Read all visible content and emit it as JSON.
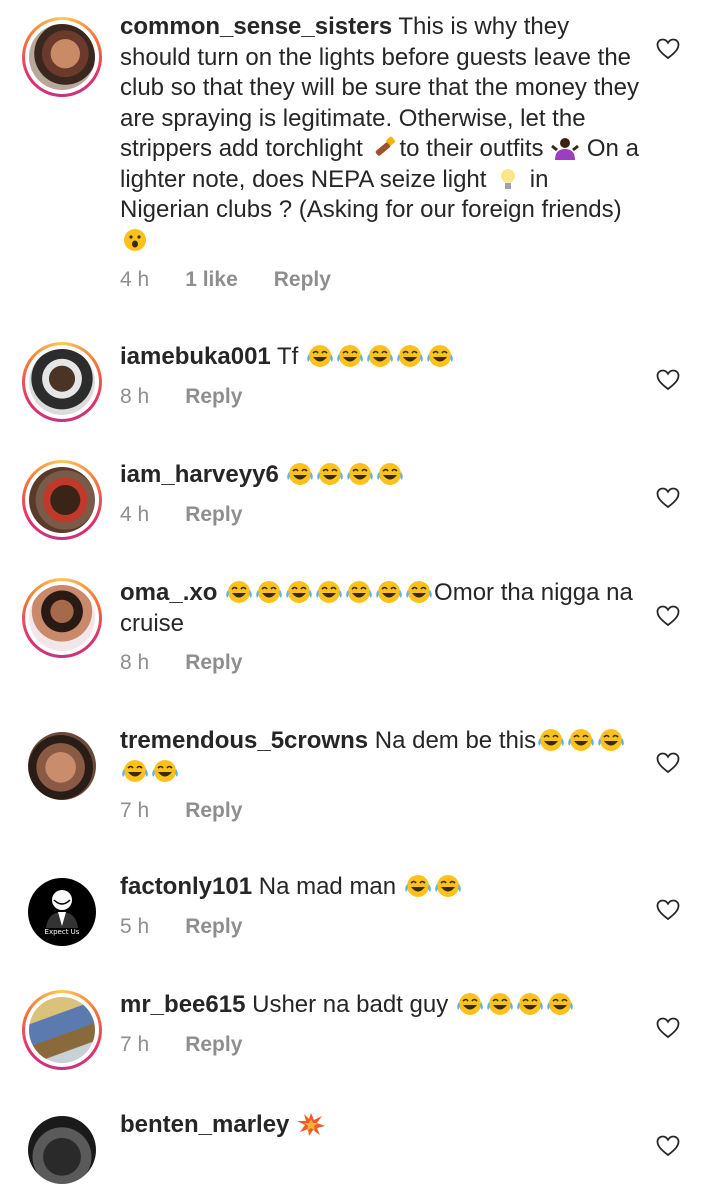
{
  "colors": {
    "text": "#262626",
    "meta": "#8e8e8e",
    "story_ring": "gradient-orange-pink"
  },
  "comments": [
    {
      "username": "common_sense_sisters",
      "text_parts": [
        "This is why they should turn on the lights before guests leave the club so that they will be sure that the money they are spraying is legitimate. Otherwise, let the strippers add torchlight ",
        "to their outfits ",
        " On a lighter note, does NEPA seize light ",
        " in Nigerian clubs ? (Asking for our foreign friends) "
      ],
      "time": "4 h",
      "likes": "1 like",
      "reply": "Reply",
      "emojis": [
        "flashlight-emoji",
        "shrug-woman-emoji",
        "light-bulb-emoji",
        "astonished-face-emoji"
      ]
    },
    {
      "username": "iamebuka001",
      "text": "Tf",
      "time": "8 h",
      "reply": "Reply",
      "emojis": [
        "laughing-tears-emoji",
        "laughing-tears-emoji",
        "laughing-tears-emoji",
        "laughing-tears-emoji",
        "laughing-tears-emoji"
      ]
    },
    {
      "username": "iam_harveyy6",
      "text": "",
      "time": "4 h",
      "reply": "Reply",
      "emojis": [
        "laughing-tears-emoji",
        "laughing-tears-emoji",
        "laughing-tears-emoji",
        "laughing-tears-emoji"
      ]
    },
    {
      "username": "oma_.xo",
      "text": "Omor tha nigga na cruise",
      "time": "8 h",
      "reply": "Reply",
      "emojis": [
        "laughing-tears-emoji",
        "laughing-tears-emoji",
        "laughing-tears-emoji",
        "laughing-tears-emoji",
        "laughing-tears-emoji",
        "laughing-tears-emoji",
        "laughing-tears-emoji"
      ]
    },
    {
      "username": "tremendous_5crowns",
      "text": "Na dem be this",
      "time": "7 h",
      "reply": "Reply",
      "emojis": [
        "laughing-tears-emoji",
        "laughing-tears-emoji",
        "laughing-tears-emoji",
        "laughing-tears-emoji",
        "laughing-tears-emoji"
      ]
    },
    {
      "username": "factonly101",
      "text": "Na mad man",
      "time": "5 h",
      "reply": "Reply",
      "avatar_caption": "Expect Us",
      "emojis": [
        "laughing-tears-emoji",
        "laughing-tears-emoji"
      ]
    },
    {
      "username": "mr_bee615",
      "text": "Usher na badt guy",
      "time": "7 h",
      "reply": "Reply",
      "emojis": [
        "laughing-tears-emoji",
        "laughing-tears-emoji",
        "laughing-tears-emoji",
        "laughing-tears-emoji"
      ]
    },
    {
      "username": "benten_marley",
      "text": "",
      "emojis": [
        "collision-emoji"
      ]
    }
  ]
}
